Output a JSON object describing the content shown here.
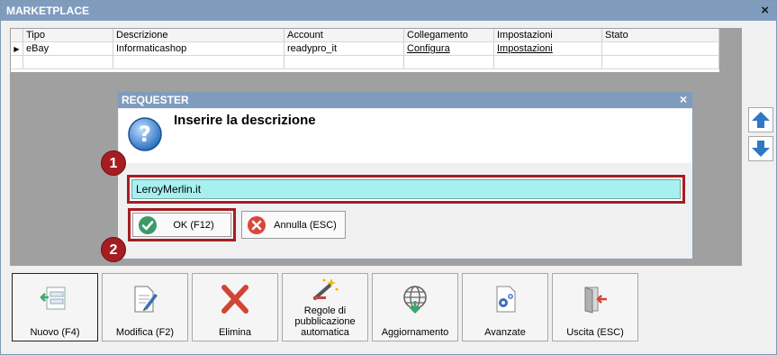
{
  "window": {
    "title": "MARKETPLACE",
    "close_glyph": "×"
  },
  "grid": {
    "columns": [
      "Tipo",
      "Descrizione",
      "Account",
      "Collegamento",
      "Impostazioni",
      "Stato"
    ],
    "rows": [
      {
        "indicator": "▶",
        "tipo": "eBay",
        "descrizione": "Informaticashop",
        "account": "readypro_it",
        "collegamento": "Configura",
        "impostazioni": "Impostazioni",
        "stato": ""
      }
    ]
  },
  "requester": {
    "title": "REQUESTER",
    "close_glyph": "×",
    "icon": "question-icon",
    "message": "Inserire la descrizione",
    "input_value": "LeroyMerlin.it",
    "ok_label": "OK (F12)",
    "cancel_label": "Annulla (ESC)"
  },
  "callouts": [
    "1",
    "2"
  ],
  "toolbar": {
    "buttons": [
      {
        "label": "Nuovo (F4)",
        "icon": "new-record-icon"
      },
      {
        "label": "Modifica (F2)",
        "icon": "edit-document-icon"
      },
      {
        "label": "Elimina",
        "icon": "delete-x-icon"
      },
      {
        "label": "Regole di pubblicazione automatica",
        "icon": "magic-wand-icon"
      },
      {
        "label": "Aggiornamento",
        "icon": "globe-download-icon"
      },
      {
        "label": "Avanzate",
        "icon": "settings-document-icon"
      },
      {
        "label": "Uscita (ESC)",
        "icon": "exit-door-icon"
      }
    ]
  },
  "colors": {
    "titlebar": "#7f9cbf",
    "callout": "#a51d21",
    "input_bg": "#a8f0f0"
  }
}
